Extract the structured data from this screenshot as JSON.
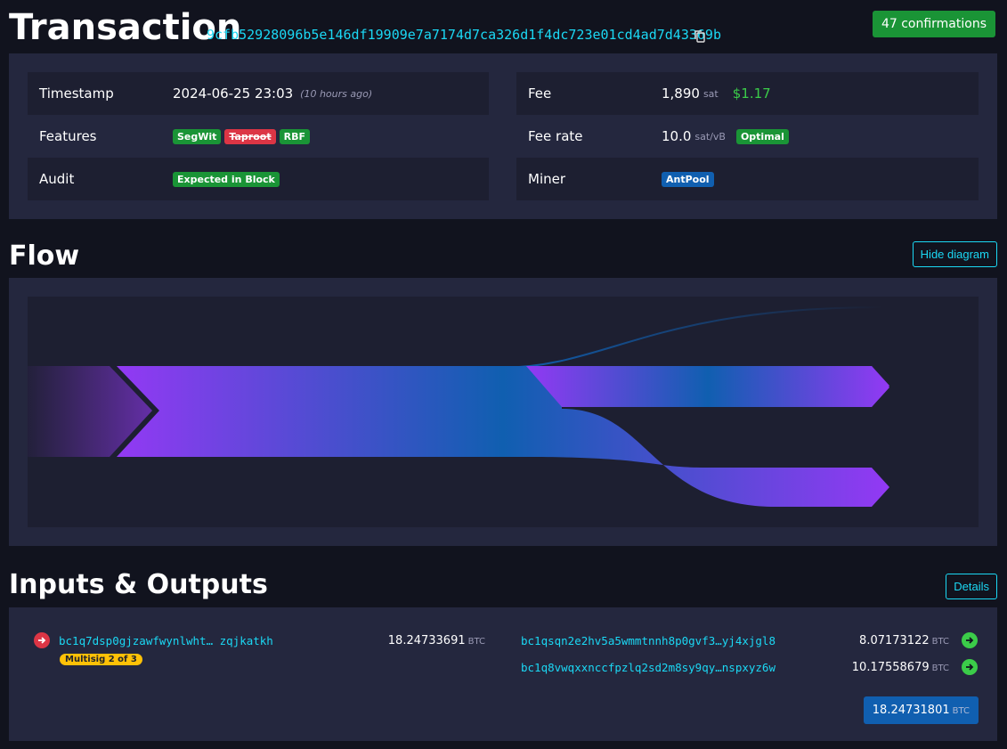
{
  "header": {
    "title": "Transaction",
    "txid": "9cfb52928096b5e146df19909e7a7174d7ca326d1f4dc723e01cd4ad7d43369b",
    "confirmations": "47 confirmations"
  },
  "details": {
    "left": [
      {
        "label": "Timestamp",
        "value": "2024-06-25 23:03",
        "extra": "(10 hours ago)"
      },
      {
        "label": "Features",
        "badges": [
          "SegWit",
          "Taproot",
          "RBF"
        ]
      },
      {
        "label": "Audit",
        "badges": [
          "Expected in Block"
        ]
      }
    ],
    "right": [
      {
        "label": "Fee",
        "value": "1,890",
        "unit": "sat",
        "usd": "$1.17"
      },
      {
        "label": "Fee rate",
        "value": "10.0",
        "unit": "sat/vB",
        "badges": [
          "Optimal"
        ]
      },
      {
        "label": "Miner",
        "badges": [
          "AntPool"
        ]
      }
    ]
  },
  "flow": {
    "title": "Flow",
    "hide_label": "Hide diagram"
  },
  "io": {
    "title": "Inputs & Outputs",
    "details_label": "Details",
    "inputs": [
      {
        "address": "bc1q7dsp0gjzawfwynlwht… zqjkatkh",
        "tag": "Multisig 2 of 3",
        "amount": "18.24733691",
        "unit": "BTC"
      }
    ],
    "outputs": [
      {
        "address": "bc1qsqn2e2hv5a5wmmtnnh8p0gvf3…yj4xjgl8",
        "amount": "8.07173122",
        "unit": "BTC"
      },
      {
        "address": "bc1q8vwqxxnccfpzlq2sd2m8sy9qy…nspxyz6w",
        "amount": "10.17558679",
        "unit": "BTC"
      }
    ],
    "total": "18.24731801",
    "total_unit": "BTC"
  },
  "colors": {
    "accent": "#1bd8f4",
    "success": "#1a9436",
    "danger": "#dc3545",
    "primary": "#105fb0",
    "flow_purple": "#9339f4"
  }
}
